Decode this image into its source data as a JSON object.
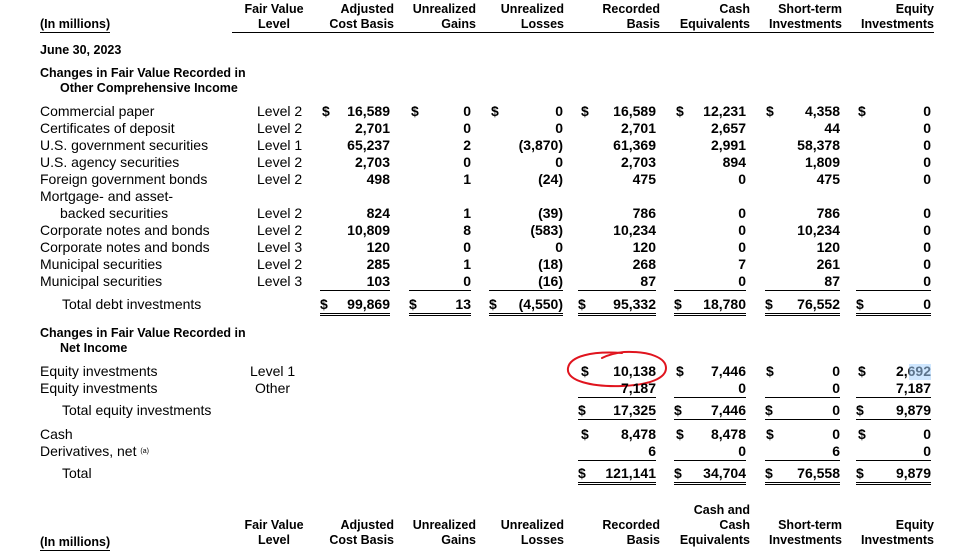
{
  "header": {
    "units": "(In millions)",
    "columns": [
      {
        "line1": "Fair Value",
        "line2": "Level"
      },
      {
        "line1": "Adjusted",
        "line2": "Cost Basis"
      },
      {
        "line1": "Unrealized",
        "line2": "Gains"
      },
      {
        "line1": "Unrealized",
        "line2": "Losses"
      },
      {
        "line1": "Recorded",
        "line2": "Basis"
      },
      {
        "line1": "Cash",
        "line2": "Equivalents"
      },
      {
        "line1": "Short-term",
        "line2": "Investments"
      },
      {
        "line1": "Equity",
        "line2": "Investments"
      }
    ]
  },
  "date": "June 30, 2023",
  "section1": {
    "line1": "Changes in Fair Value Recorded in",
    "line2": "Other Comprehensive Income"
  },
  "debt_rows": [
    {
      "name": "Commercial paper",
      "level": "Level 2",
      "cost": "16,589",
      "gains": "0",
      "losses": "0",
      "basis": "16,589",
      "cash": "12,231",
      "st": "4,358",
      "eq": "0"
    },
    {
      "name": "Certificates of deposit",
      "level": "Level 2",
      "cost": "2,701",
      "gains": "0",
      "losses": "0",
      "basis": "2,701",
      "cash": "2,657",
      "st": "44",
      "eq": "0"
    },
    {
      "name": "U.S. government securities",
      "level": "Level 1",
      "cost": "65,237",
      "gains": "2",
      "losses": "(3,870)",
      "basis": "61,369",
      "cash": "2,991",
      "st": "58,378",
      "eq": "0"
    },
    {
      "name": "U.S. agency securities",
      "level": "Level 2",
      "cost": "2,703",
      "gains": "0",
      "losses": "0",
      "basis": "2,703",
      "cash": "894",
      "st": "1,809",
      "eq": "0"
    },
    {
      "name": "Foreign government bonds",
      "level": "Level 2",
      "cost": "498",
      "gains": "1",
      "losses": "(24)",
      "basis": "475",
      "cash": "0",
      "st": "475",
      "eq": "0"
    },
    {
      "name": "Mortgage- and asset-",
      "level": "",
      "cost": "",
      "gains": "",
      "losses": "",
      "basis": "",
      "cash": "",
      "st": "",
      "eq": ""
    },
    {
      "name": "backed securities",
      "level": "Level 2",
      "cost": "824",
      "gains": "1",
      "losses": "(39)",
      "basis": "786",
      "cash": "0",
      "st": "786",
      "eq": "0"
    },
    {
      "name": "Corporate notes and bonds",
      "level": "Level 2",
      "cost": "10,809",
      "gains": "8",
      "losses": "(583)",
      "basis": "10,234",
      "cash": "0",
      "st": "10,234",
      "eq": "0"
    },
    {
      "name": "Corporate notes and bonds",
      "level": "Level 3",
      "cost": "120",
      "gains": "0",
      "losses": "0",
      "basis": "120",
      "cash": "0",
      "st": "120",
      "eq": "0"
    },
    {
      "name": "Municipal securities",
      "level": "Level 2",
      "cost": "285",
      "gains": "1",
      "losses": "(18)",
      "basis": "268",
      "cash": "7",
      "st": "261",
      "eq": "0"
    },
    {
      "name": "Municipal securities",
      "level": "Level 3",
      "cost": "103",
      "gains": "0",
      "losses": "(16)",
      "basis": "87",
      "cash": "0",
      "st": "87",
      "eq": "0"
    }
  ],
  "total_debt": {
    "name": "Total debt investments",
    "cost": "99,869",
    "gains": "13",
    "losses": "(4,550)",
    "basis": "95,332",
    "cash": "18,780",
    "st": "76,552",
    "eq": "0"
  },
  "section2": {
    "line1": "Changes in Fair Value Recorded in",
    "line2": "Net Income"
  },
  "equity_rows": [
    {
      "name": "Equity investments",
      "level": "Level 1",
      "basis": "10,138",
      "cash": "7,446",
      "st": "0",
      "eq": "2,692"
    },
    {
      "name": "Equity investments",
      "level": "Other",
      "basis": "7,187",
      "cash": "0",
      "st": "0",
      "eq": "7,187"
    }
  ],
  "total_equity": {
    "name": "Total equity investments",
    "basis": "17,325",
    "cash": "7,446",
    "st": "0",
    "eq": "9,879"
  },
  "cash_row": {
    "name": "Cash",
    "basis": "8,478",
    "cash": "8,478",
    "st": "0",
    "eq": "0"
  },
  "deriv_row": {
    "name": "Derivatives, net",
    "footnote": "(a)",
    "basis": "6",
    "cash": "0",
    "st": "6",
    "eq": "0"
  },
  "total_row": {
    "name": "Total",
    "basis": "121,141",
    "cash": "34,704",
    "st": "76,558",
    "eq": "9,879"
  },
  "footer_header": {
    "units": "(In millions)",
    "cash_top": "Cash and",
    "columns": [
      {
        "line1": "Fair Value",
        "line2": "Level"
      },
      {
        "line1": "Adjusted",
        "line2": "Cost Basis"
      },
      {
        "line1": "Unrealized",
        "line2": "Gains"
      },
      {
        "line1": "Unrealized",
        "line2": "Losses"
      },
      {
        "line1": "Recorded",
        "line2": "Basis"
      },
      {
        "line1": "Cash",
        "line2": "Equivalents"
      },
      {
        "line1": "Short-term",
        "line2": "Investments"
      },
      {
        "line1": "Equity",
        "line2": "Investments"
      }
    ]
  },
  "dollar": "$",
  "annotation_color": "#e0141e",
  "highlight_color": "#a8d4ff"
}
